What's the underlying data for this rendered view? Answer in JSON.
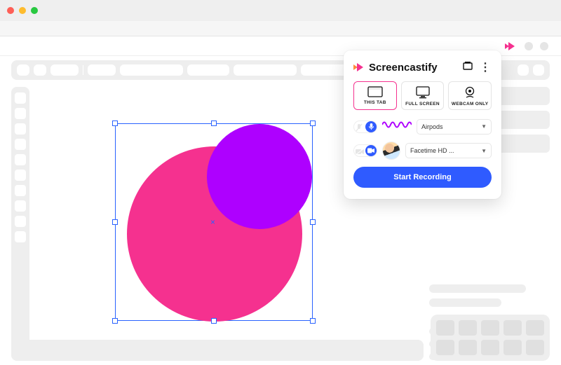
{
  "brand": {
    "name": "Screencastify"
  },
  "modes": {
    "thisTab": {
      "label": "THIS TAB"
    },
    "fullScreen": {
      "label": "FULL SCREEN"
    },
    "webcamOnly": {
      "label": "WEBCAM ONLY"
    },
    "selected": "thisTab"
  },
  "audio": {
    "device": "Airpods"
  },
  "camera": {
    "device": "Facetime HD ..."
  },
  "actions": {
    "record": "Start Recording"
  },
  "colors": {
    "pink": "#f5318f",
    "purple": "#ae00ff",
    "blue": "#2f5bff",
    "selection": "#2962ff"
  }
}
